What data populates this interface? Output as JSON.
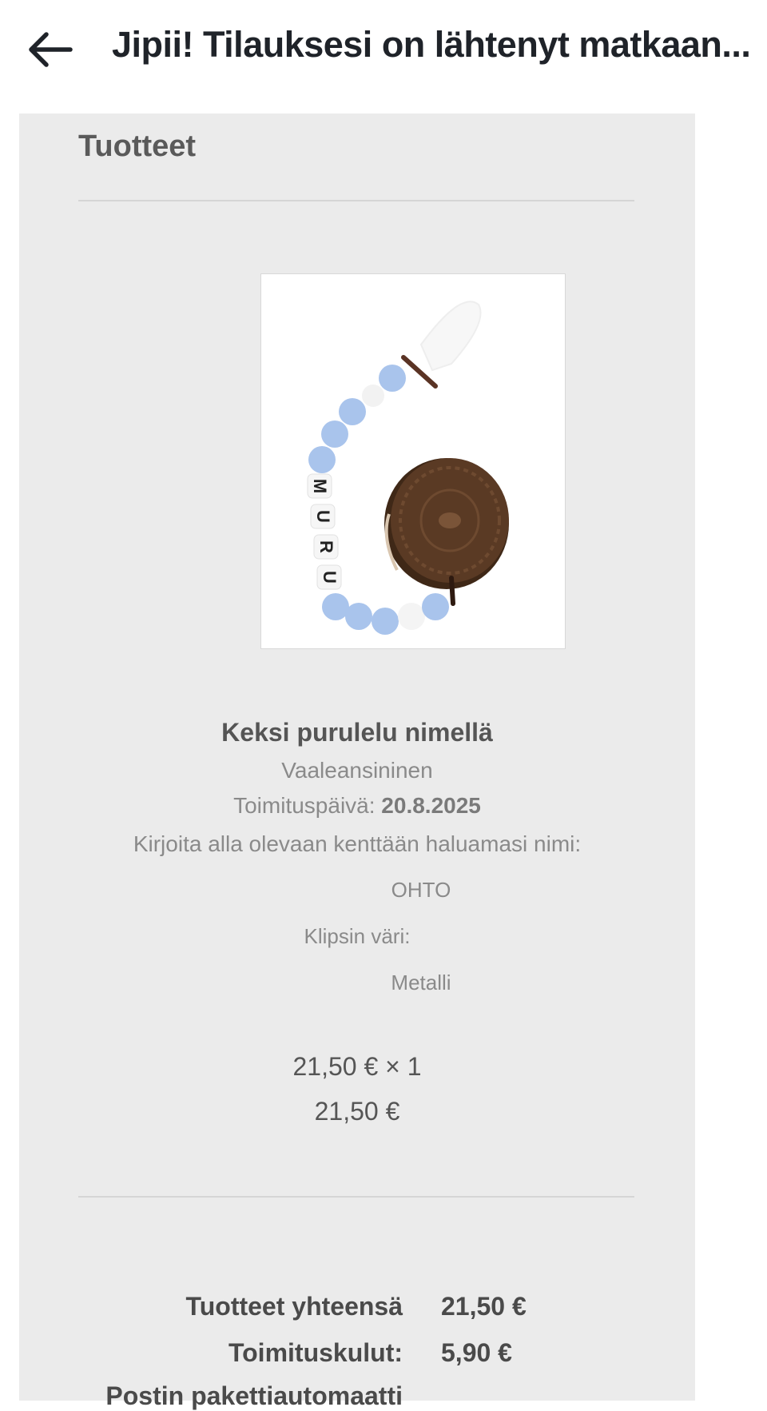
{
  "header": {
    "title": "Jipii! Tilauksesi on lähtenyt matkaan..."
  },
  "products_section": {
    "heading": "Tuotteet",
    "item": {
      "name": "Keksi purulelu nimellä",
      "variant": "Vaaleansininen",
      "delivery_label": "Toimituspäivä: ",
      "delivery_date": "20.8.2025",
      "name_prompt": "Kirjoita alla olevaan kenttään haluamasi nimi:",
      "name_value": "OHTO",
      "clip_label": "Klipsin väri:",
      "clip_value": "Metalli",
      "unit_price_qty": "21,50 € × 1",
      "line_total": "21,50 €",
      "image_letters": [
        "M",
        "U",
        "R",
        "U"
      ]
    }
  },
  "totals": {
    "products_label": "Tuotteet yhteensä",
    "products_value": "21,50 €",
    "shipping_label": "Toimituskulut:",
    "shipping_value": "5,90 €",
    "partial_label": "Postin pakettiautomaatti"
  },
  "colors": {
    "panel_bg": "#ebebeb",
    "title_text": "#1f2329",
    "bead_blue": "#a9c4ec",
    "cookie_brown": "#5a3a24"
  }
}
